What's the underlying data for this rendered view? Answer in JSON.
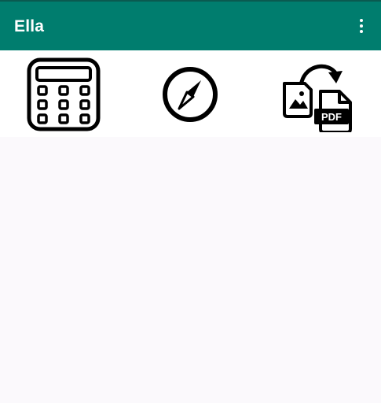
{
  "appbar": {
    "title": "Ella",
    "background_color": "#007d6e",
    "menu_icon": "more-vert-icon"
  },
  "tools": [
    {
      "name": "calculator",
      "icon": "calculator-icon"
    },
    {
      "name": "compass",
      "icon": "compass-icon"
    },
    {
      "name": "image-to-pdf",
      "icon": "image-to-pdf-icon",
      "badge_text": "PDF"
    }
  ]
}
